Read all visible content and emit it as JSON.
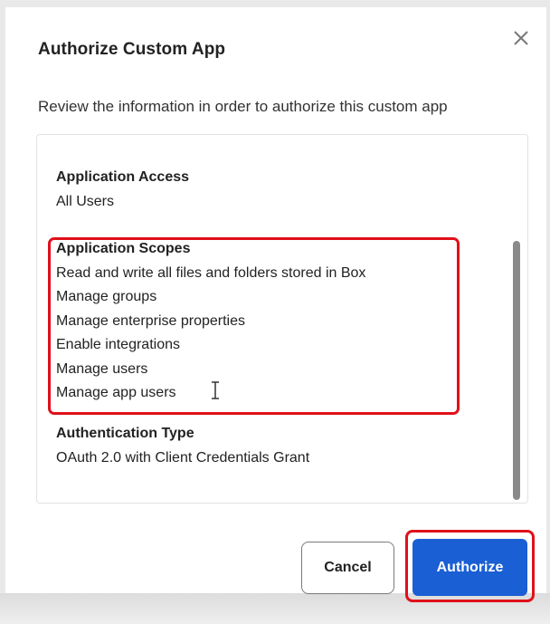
{
  "dialog": {
    "title": "Authorize Custom App",
    "subtitle": "Review the information in order to authorize this custom app",
    "close_icon": "close-icon"
  },
  "details": {
    "access": {
      "heading": "Application Access",
      "value": "All Users"
    },
    "scopes": {
      "heading": "Application Scopes",
      "items": [
        "Read and write all files and folders stored in Box",
        "Manage groups",
        "Manage enterprise properties",
        "Enable integrations",
        "Manage users",
        "Manage app users"
      ]
    },
    "auth": {
      "heading": "Authentication Type",
      "value": "OAuth 2.0 with Client Credentials Grant"
    }
  },
  "buttons": {
    "cancel_label": "Cancel",
    "authorize_label": "Authorize"
  },
  "colors": {
    "highlight": "#e0101a",
    "primary": "#1a5fd4"
  }
}
